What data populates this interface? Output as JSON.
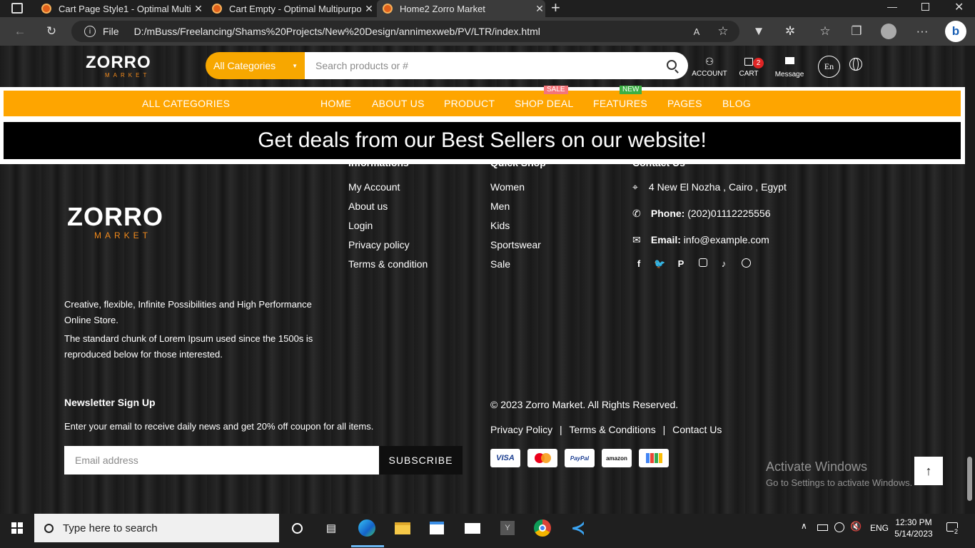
{
  "browser": {
    "tabs": [
      {
        "title": "Cart Page Style1 - Optimal Multi",
        "active": false
      },
      {
        "title": "Cart Empty - Optimal Multipurpo",
        "active": false
      },
      {
        "title": "Home2 Zorro Market",
        "active": true
      }
    ],
    "new_tab": "+",
    "file_label": "File",
    "url": "D:/mBuss/Freelancing/Shams%20Projects/New%20Design/annimexweb/PV/LTR/index.html",
    "more": "···"
  },
  "site": {
    "logo_main": "ZORRO",
    "logo_sub": "MARKET",
    "category_button": "All Categories",
    "search_placeholder": "Search products or #",
    "account_label": "ACCOUNT",
    "cart_label": "CART",
    "cart_count": "2",
    "message_label": "Message",
    "lang_label": "En",
    "nav": {
      "all_categories": "ALL CATEGORIES",
      "home": "HOME",
      "about": "ABOUT US",
      "product": "PRODUCT",
      "shop_deal": "SHOP DEAL",
      "shop_deal_badge": "SALE",
      "features": "FEATURES",
      "features_badge": "NEW",
      "pages": "PAGES",
      "blog": "BLOG"
    },
    "banner": "Get deals from our Best Sellers on our website!"
  },
  "footer": {
    "about_text_1": "Creative, flexible, Infinite Possibilities and High Performance Online Store.",
    "about_text_2": "The standard chunk of Lorem Ipsum used since the 1500s is reproduced below for those interested.",
    "informations": {
      "title": "Informations",
      "links": [
        "My Account",
        "About us",
        "Login",
        "Privacy policy",
        "Terms & condition"
      ]
    },
    "quick_shop": {
      "title": "Quick Shop",
      "links": [
        "Women",
        "Men",
        "Kids",
        "Sportswear",
        "Sale"
      ]
    },
    "contact": {
      "title": "Contact Us",
      "address": "4 New El Nozha , Cairo , Egypt",
      "phone_label": "Phone:",
      "phone": "(202)01112225556",
      "email_label": "Email:",
      "email": "info@example.com"
    },
    "newsletter": {
      "title": "Newsletter Sign Up",
      "text": "Enter your email to receive daily news and get 20% off coupon for all items.",
      "placeholder": "Email address",
      "button": "SUBSCRIBE"
    },
    "copyright": "© 2023 Zorro Market. All Rights Reserved.",
    "legal_links": [
      "Privacy Policy",
      "Terms & Conditions",
      "Contact Us"
    ],
    "separator": "|",
    "payments": [
      "VISA",
      "MasterCard",
      "PayPal",
      "amazon",
      "Google Wallet"
    ]
  },
  "watermark": {
    "title": "Activate Windows",
    "subtitle": "Go to Settings to activate Windows."
  },
  "taskbar": {
    "search_placeholder": "Type here to search",
    "language": "ENG",
    "time": "12:30 PM",
    "date": "5/14/2023",
    "notification_count": "2"
  }
}
